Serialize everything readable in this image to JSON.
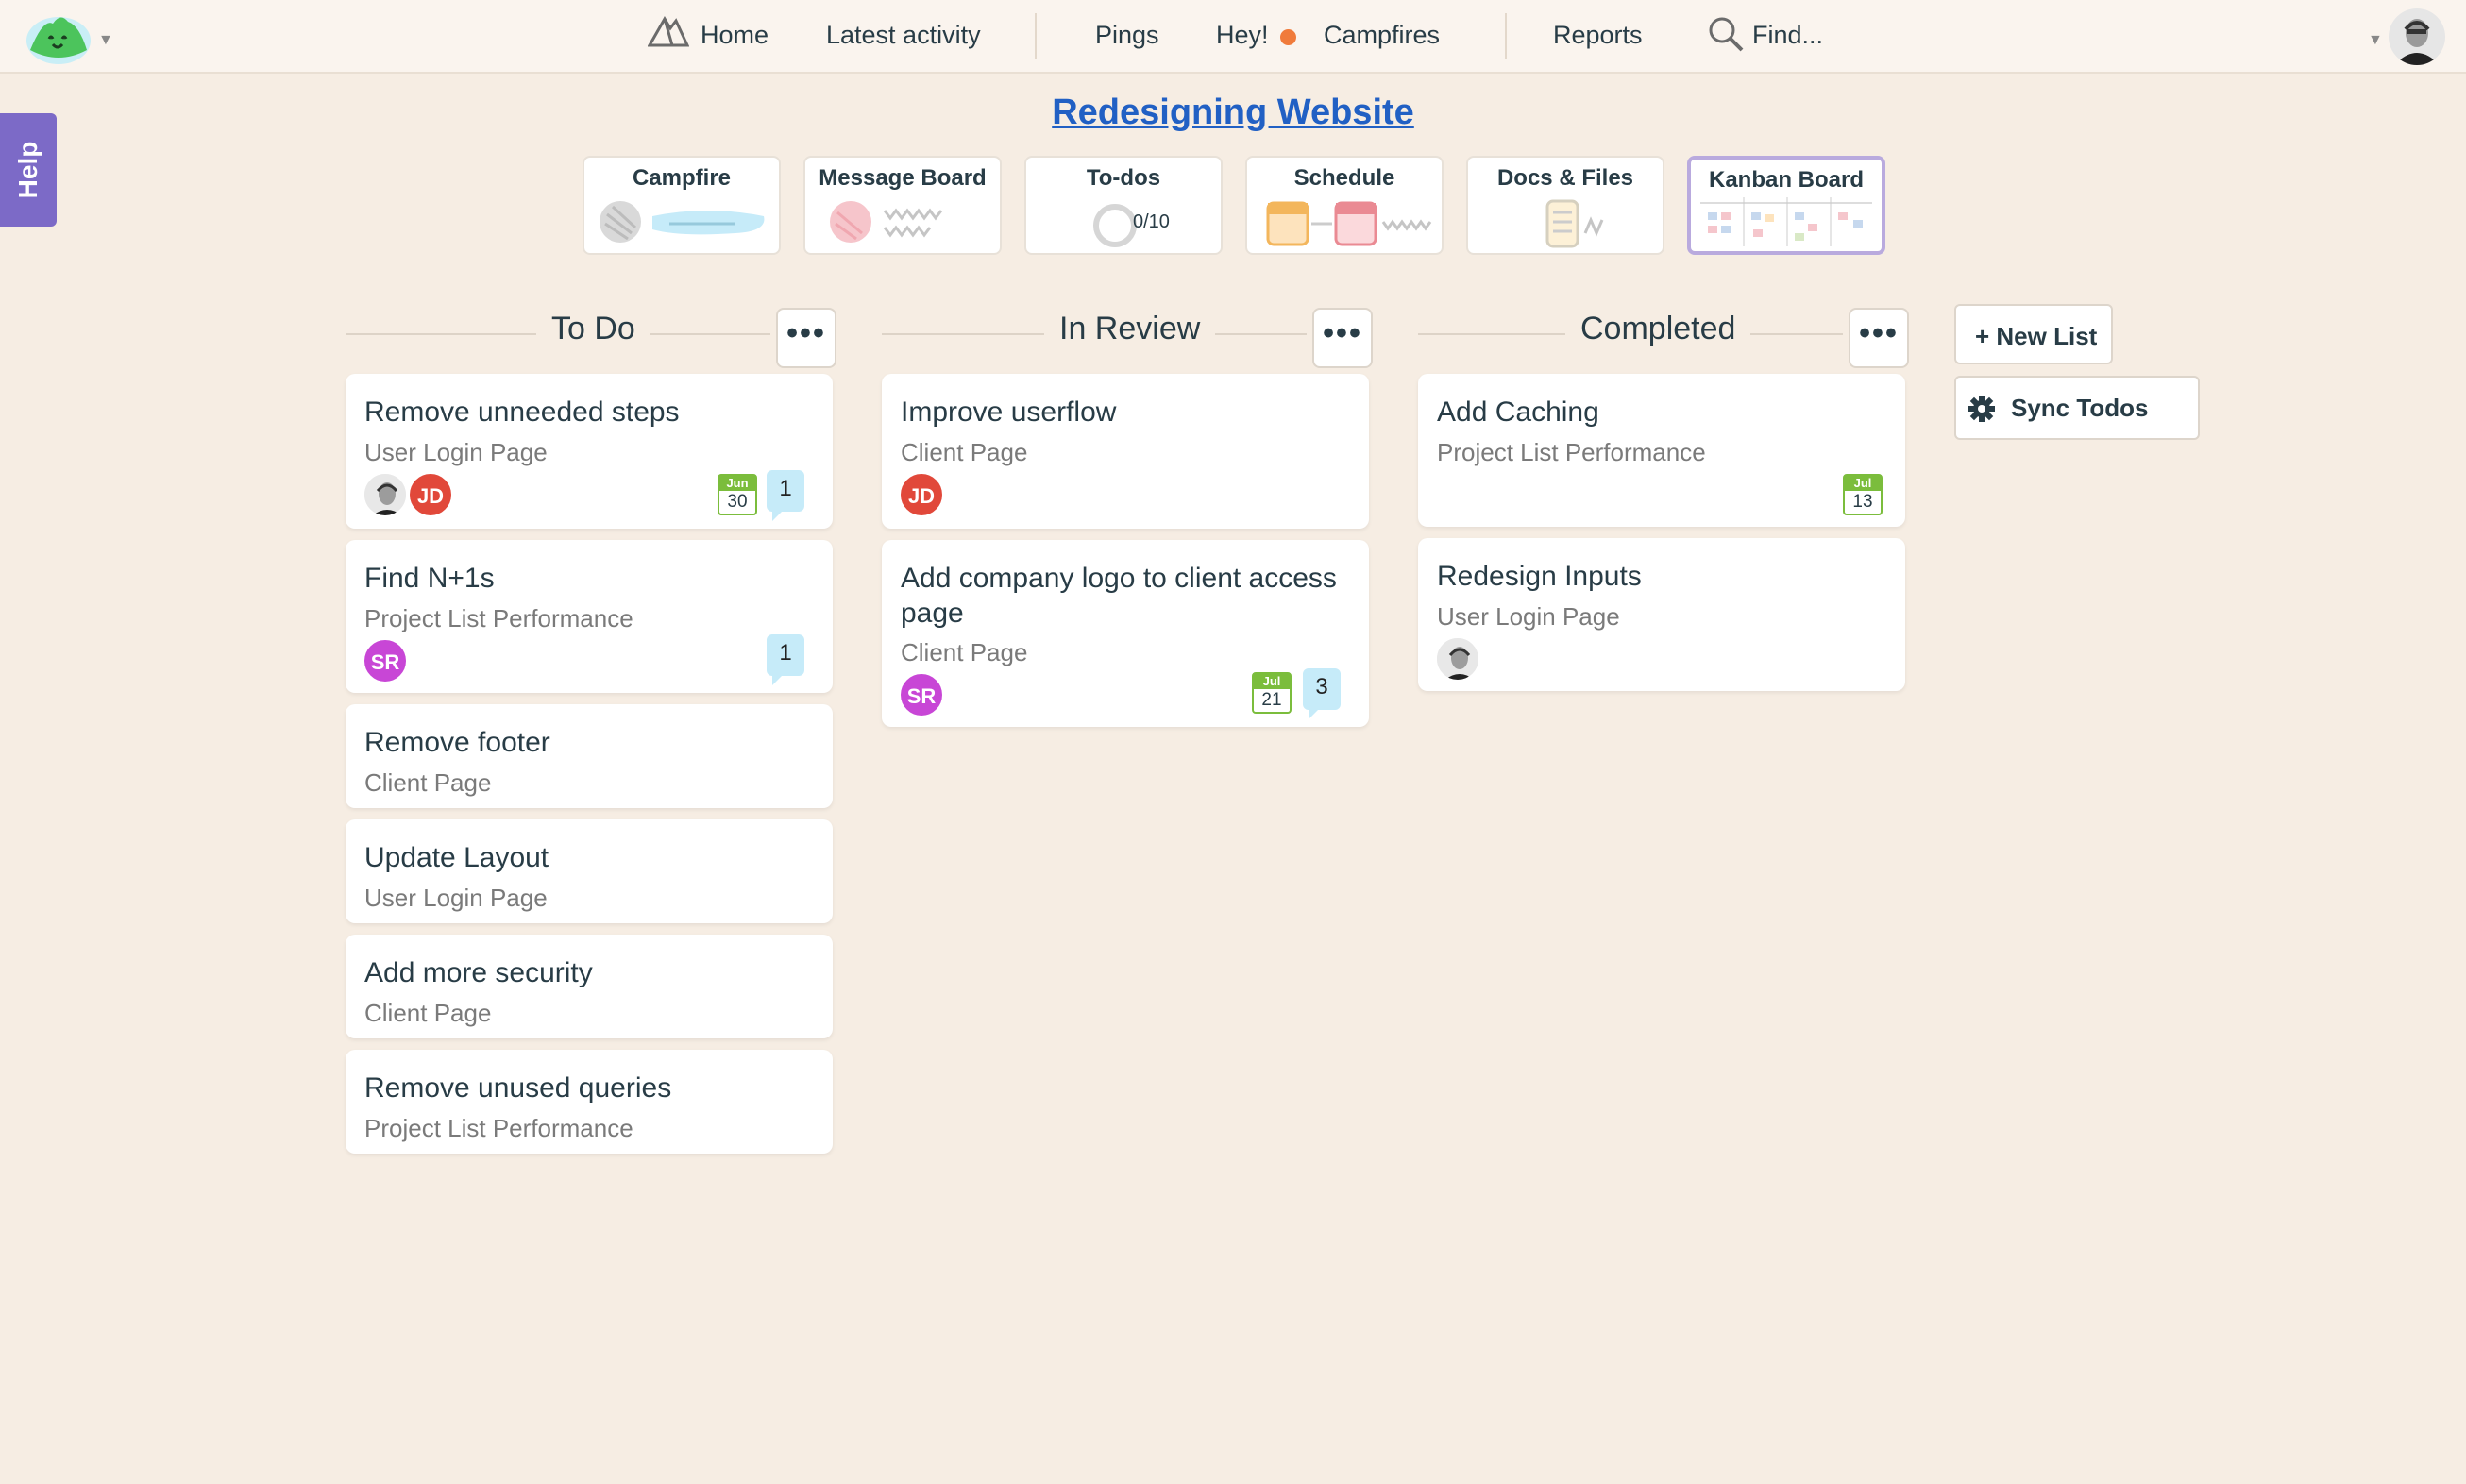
{
  "nav": {
    "home": "Home",
    "latest_activity": "Latest activity",
    "pings": "Pings",
    "hey": "Hey!",
    "campfires": "Campfires",
    "reports": "Reports",
    "find": "Find..."
  },
  "help": "Help",
  "project_title": "Redesigning Website",
  "tools": [
    {
      "title": "Campfire"
    },
    {
      "title": "Message Board"
    },
    {
      "title": "To-dos",
      "progress": "0/10"
    },
    {
      "title": "Schedule"
    },
    {
      "title": "Docs & Files"
    },
    {
      "title": "Kanban Board"
    }
  ],
  "columns": [
    {
      "title": "To Do",
      "cards": [
        {
          "title": "Remove unneeded steps",
          "sub": "User Login Page",
          "due_month": "Jun",
          "due_day": "30",
          "comments": "1"
        },
        {
          "title": "Find N+1s",
          "sub": "Project List Performance",
          "avatar": "SR",
          "comments": "1"
        },
        {
          "title": "Remove footer",
          "sub": "Client Page"
        },
        {
          "title": "Update Layout",
          "sub": "User Login Page"
        },
        {
          "title": "Add more security",
          "sub": "Client Page"
        },
        {
          "title": "Remove unused queries",
          "sub": "Project List Performance"
        }
      ]
    },
    {
      "title": "In Review",
      "cards": [
        {
          "title": "Improve userflow",
          "sub": "Client Page",
          "avatar": "JD"
        },
        {
          "title": "Add company logo to client access page",
          "sub": "Client Page",
          "avatar": "SR",
          "due_month": "Jul",
          "due_day": "21",
          "comments": "3"
        }
      ]
    },
    {
      "title": "Completed",
      "cards": [
        {
          "title": "Add Caching",
          "sub": "Project List Performance",
          "due_month": "Jul",
          "due_day": "13"
        },
        {
          "title": "Redesign Inputs",
          "sub": "User Login Page"
        }
      ]
    }
  ],
  "avatars": {
    "jd": "JD",
    "sr": "SR"
  },
  "more_label": "•••",
  "new_list": "+ New List",
  "sync_todos": "Sync Todos",
  "colors": {
    "background": "#f6ede3",
    "link": "#2160c4",
    "help": "#7c6ac7",
    "jd": "#e1483a",
    "sr": "#c846d6",
    "due": "#7bbd3c",
    "comment": "#c6ebf9",
    "hey_dot": "#f07b3b"
  }
}
